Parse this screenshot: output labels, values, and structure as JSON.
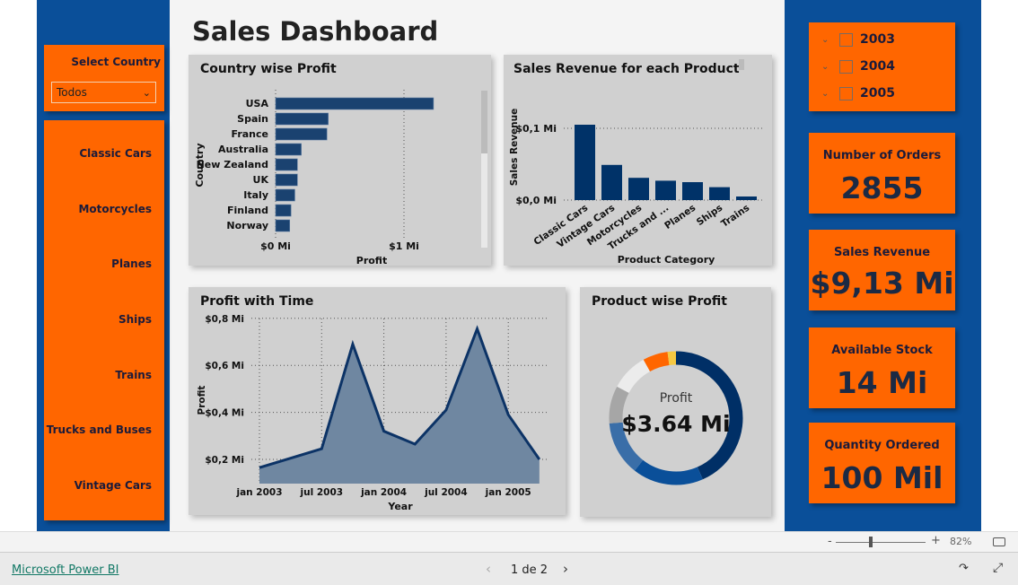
{
  "title": "Sales Dashboard",
  "filter": {
    "label": "Select Country",
    "value": "Todos"
  },
  "categories": [
    "Classic Cars",
    "Motorcycles",
    "Planes",
    "Ships",
    "Trains",
    "Trucks and Buses",
    "Vintage Cars"
  ],
  "years": [
    "2003",
    "2004",
    "2005"
  ],
  "kpis": [
    {
      "label": "Number of Orders",
      "value": "2855"
    },
    {
      "label": "Sales Revenue",
      "value": "$9,13 Mi"
    },
    {
      "label": "Available Stock",
      "value": "14 Mi"
    },
    {
      "label": "Quantity Ordered",
      "value": "100 Mil"
    }
  ],
  "colors": {
    "panel": "#0a4f99",
    "accent": "#ff6600",
    "bar": "#1a4270",
    "navy": "#002f66"
  },
  "chart_data": [
    {
      "type": "bar",
      "orientation": "horizontal",
      "title": "Country wise Profit",
      "xlabel": "Profit",
      "ylabel": "Country",
      "categories": [
        "USA",
        "Spain",
        "France",
        "Australia",
        "New Zealand",
        "UK",
        "Italy",
        "Finland",
        "Norway"
      ],
      "values": [
        1.23,
        0.41,
        0.4,
        0.2,
        0.17,
        0.17,
        0.15,
        0.12,
        0.11
      ],
      "xticks": [
        "$0 Mi",
        "$1 Mi"
      ],
      "xlim": [
        0,
        1.3
      ],
      "grid": true
    },
    {
      "type": "bar",
      "title": "Sales Revenue for each Product",
      "xlabel": "Product Category",
      "ylabel": "Sales Revenue",
      "categories": [
        "Classic Cars",
        "Vintage Cars",
        "Motorcycles",
        "Trucks and ...",
        "Planes",
        "Ships",
        "Trains"
      ],
      "values": [
        0.105,
        0.049,
        0.031,
        0.027,
        0.025,
        0.018,
        0.005
      ],
      "yticks": [
        "$0,0 Mi",
        "$0,1 Mi"
      ],
      "ylim": [
        0,
        0.12
      ],
      "grid": true
    },
    {
      "type": "area",
      "title": "Profit with Time",
      "xlabel": "Year",
      "ylabel": "Profit",
      "x": [
        "2003-01",
        "2003-07",
        "2003-10",
        "2004-01",
        "2004-04",
        "2004-07",
        "2004-10",
        "2005-01",
        "2005-04"
      ],
      "values": [
        0.165,
        0.245,
        0.69,
        0.32,
        0.265,
        0.41,
        0.755,
        0.39,
        0.2
      ],
      "xticks": [
        "jan 2003",
        "jul 2003",
        "jan 2004",
        "jul 2004",
        "jan 2005"
      ],
      "yticks": [
        "$0,2 Mi",
        "$0,4 Mi",
        "$0,6 Mi",
        "$0,8 Mi"
      ],
      "ylim": [
        0.1,
        0.82
      ],
      "grid": true
    },
    {
      "type": "pie",
      "variant": "donut",
      "title": "Product wise Profit",
      "center_label": "Profit",
      "center_value": "$3.64 Mi",
      "values": [
        43,
        17,
        13,
        9,
        9,
        6,
        2
      ],
      "colors": [
        "#002f66",
        "#0a4f99",
        "#3a6ea8",
        "#a6a6a6",
        "#ececec",
        "#ff6600",
        "#f5c842"
      ]
    }
  ],
  "footer": {
    "zoom": "82%",
    "zoom_minus": "-",
    "zoom_plus": "+",
    "brand": "Microsoft Power BI",
    "page": "1 de 2"
  }
}
